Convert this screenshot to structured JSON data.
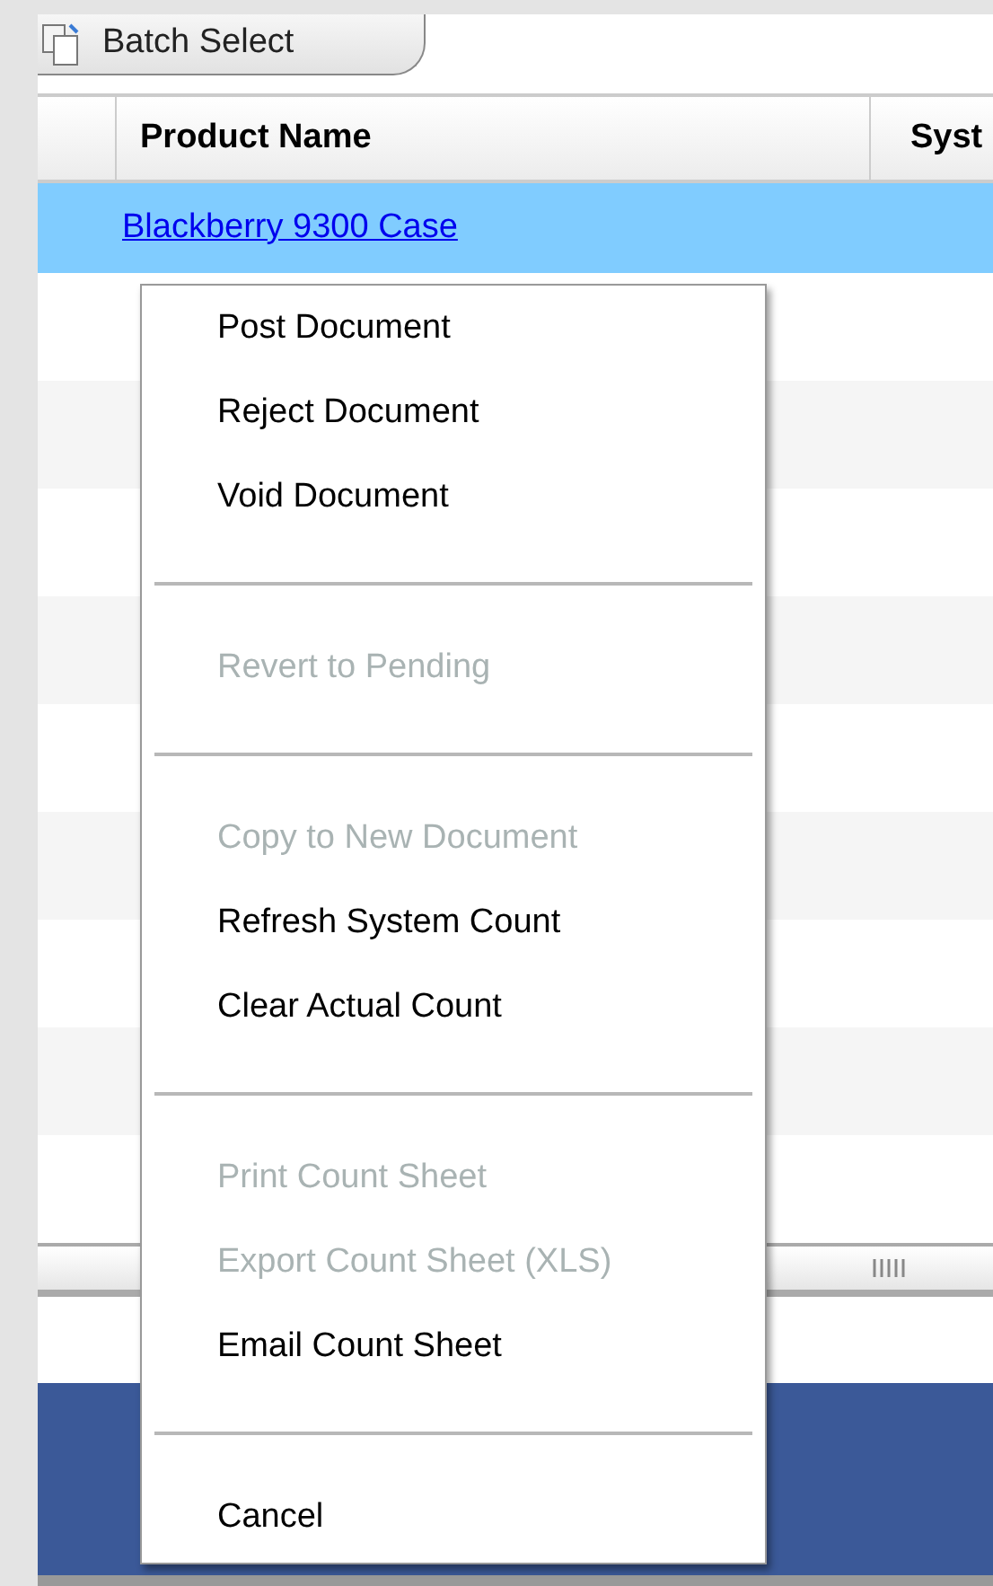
{
  "toolbar": {
    "batch_select_button": "Batch Select"
  },
  "table": {
    "columns": [
      "Product Name",
      "Syst"
    ],
    "rows": [
      {
        "product_name": "Blackberry 9300 Case",
        "selected": true
      }
    ]
  },
  "context_menu": {
    "groups": [
      {
        "items": [
          {
            "label": "Post Document",
            "disabled": false
          },
          {
            "label": "Reject Document",
            "disabled": false
          },
          {
            "label": "Void Document",
            "disabled": false
          }
        ]
      },
      {
        "items": [
          {
            "label": "Revert to Pending",
            "disabled": true
          }
        ]
      },
      {
        "items": [
          {
            "label": "Copy to New Document",
            "disabled": true
          },
          {
            "label": "Refresh System Count",
            "disabled": false
          },
          {
            "label": "Clear Actual Count",
            "disabled": false
          }
        ]
      },
      {
        "items": [
          {
            "label": "Print Count Sheet",
            "disabled": true
          },
          {
            "label": "Export Count Sheet (XLS)",
            "disabled": true
          },
          {
            "label": "Email Count Sheet",
            "disabled": false
          }
        ]
      },
      {
        "items": [
          {
            "label": "Cancel",
            "disabled": false
          }
        ]
      }
    ]
  }
}
